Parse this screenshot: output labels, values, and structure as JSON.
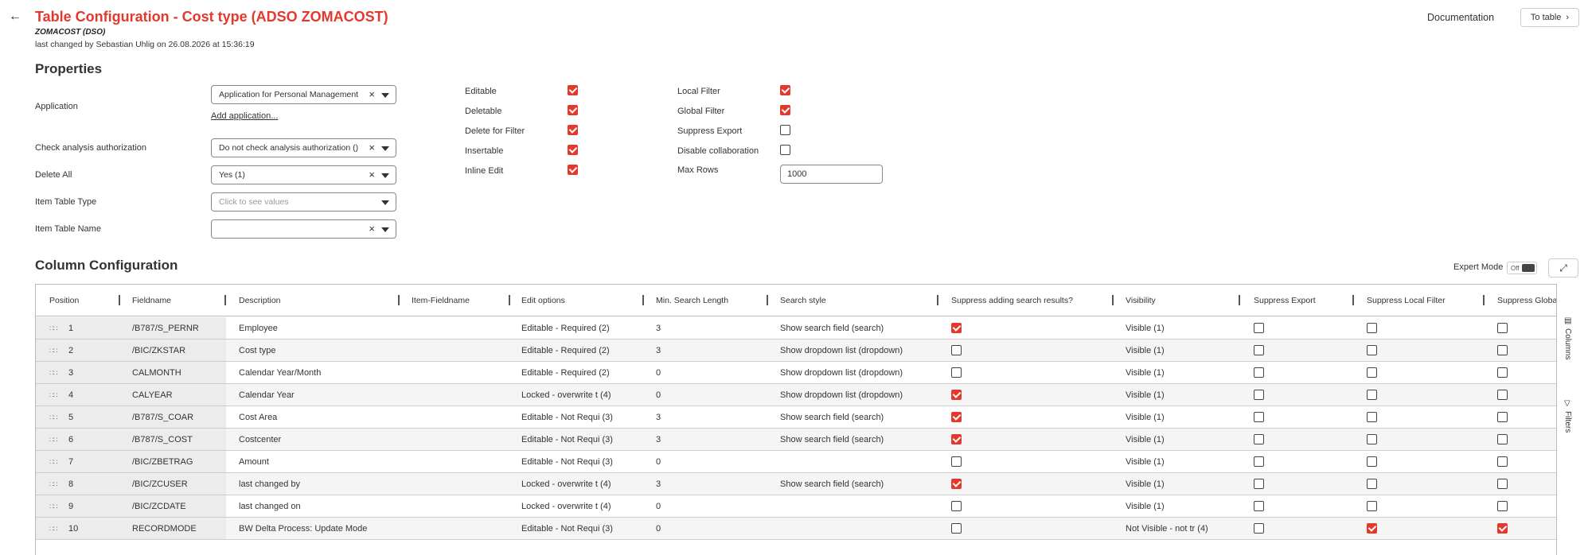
{
  "header": {
    "title": "Table Configuration - Cost type (ADSO ZOMACOST)",
    "subtitle": "ZOMACOST (DSO)",
    "changed": "last changed by Sebastian Uhlig on 26.08.2026 at 15:36:19",
    "documentation": "Documentation",
    "to_table": "To table"
  },
  "properties": {
    "heading": "Properties",
    "application": {
      "label": "Application",
      "value": "Application for Personal Management",
      "add": "Add application..."
    },
    "check_auth": {
      "label": "Check analysis authorization",
      "value": "Do not check analysis authorization ()"
    },
    "delete_all": {
      "label": "Delete All",
      "value": "Yes (1)"
    },
    "item_table_type": {
      "label": "Item Table Type",
      "placeholder": "Click to see values"
    },
    "item_table_name": {
      "label": "Item Table Name",
      "value": ""
    },
    "flags_left": [
      {
        "label": "Editable",
        "checked": true
      },
      {
        "label": "Deletable",
        "checked": true
      },
      {
        "label": "Delete for Filter",
        "checked": true
      },
      {
        "label": "Insertable",
        "checked": true
      },
      {
        "label": "Inline Edit",
        "checked": true
      }
    ],
    "flags_right": [
      {
        "label": "Local Filter",
        "checked": true
      },
      {
        "label": "Global Filter",
        "checked": true
      },
      {
        "label": "Suppress Export",
        "checked": false
      },
      {
        "label": "Disable collaboration",
        "checked": false
      }
    ],
    "max_rows": {
      "label": "Max Rows",
      "value": "1000"
    }
  },
  "columns": {
    "heading": "Column Configuration",
    "expert_mode": "Expert Mode",
    "toggle_state": "Off",
    "side_columns": "Columns",
    "side_filters": "Filters",
    "headers": [
      "Position",
      "Fieldname",
      "Description",
      "Item-Fieldname",
      "Edit options",
      "Min. Search Length",
      "Search style",
      "Suppress adding search results?",
      "Visibility",
      "Suppress Export",
      "Suppress Local Filter",
      "Suppress Global Filter"
    ],
    "rows": [
      {
        "pos": "1",
        "field": "/B787/S_PERNR",
        "desc": "Employee",
        "item": "",
        "edit": "Editable - Required (2)",
        "min": "3",
        "style": "Show search field (search)",
        "sup_add": true,
        "vis": "Visible (1)",
        "sup_exp": false,
        "sup_loc": false,
        "sup_glob": false
      },
      {
        "pos": "2",
        "field": "/BIC/ZKSTAR",
        "desc": "Cost type",
        "item": "",
        "edit": "Editable - Required (2)",
        "min": "3",
        "style": "Show dropdown list (dropdown)",
        "sup_add": false,
        "vis": "Visible (1)",
        "sup_exp": false,
        "sup_loc": false,
        "sup_glob": false
      },
      {
        "pos": "3",
        "field": "CALMONTH",
        "desc": "Calendar Year/Month",
        "item": "",
        "edit": "Editable - Required (2)",
        "min": "0",
        "style": "Show dropdown list (dropdown)",
        "sup_add": false,
        "vis": "Visible (1)",
        "sup_exp": false,
        "sup_loc": false,
        "sup_glob": false
      },
      {
        "pos": "4",
        "field": "CALYEAR",
        "desc": "Calendar Year",
        "item": "",
        "edit": "Locked - overwrite t (4)",
        "min": "0",
        "style": "Show dropdown list (dropdown)",
        "sup_add": true,
        "vis": "Visible (1)",
        "sup_exp": false,
        "sup_loc": false,
        "sup_glob": false
      },
      {
        "pos": "5",
        "field": "/B787/S_COAR",
        "desc": "Cost Area",
        "item": "",
        "edit": "Editable - Not Requi (3)",
        "min": "3",
        "style": "Show search field (search)",
        "sup_add": true,
        "vis": "Visible (1)",
        "sup_exp": false,
        "sup_loc": false,
        "sup_glob": false
      },
      {
        "pos": "6",
        "field": "/B787/S_COST",
        "desc": "Costcenter",
        "item": "",
        "edit": "Editable - Not Requi (3)",
        "min": "3",
        "style": "Show search field (search)",
        "sup_add": true,
        "vis": "Visible (1)",
        "sup_exp": false,
        "sup_loc": false,
        "sup_glob": false
      },
      {
        "pos": "7",
        "field": "/BIC/ZBETRAG",
        "desc": "Amount",
        "item": "",
        "edit": "Editable - Not Requi (3)",
        "min": "0",
        "style": "",
        "sup_add": false,
        "vis": "Visible (1)",
        "sup_exp": false,
        "sup_loc": false,
        "sup_glob": false
      },
      {
        "pos": "8",
        "field": "/BIC/ZCUSER",
        "desc": "last changed by",
        "item": "",
        "edit": "Locked - overwrite t (4)",
        "min": "3",
        "style": "Show search field (search)",
        "sup_add": true,
        "vis": "Visible (1)",
        "sup_exp": false,
        "sup_loc": false,
        "sup_glob": false
      },
      {
        "pos": "9",
        "field": "/BIC/ZCDATE",
        "desc": "last changed on",
        "item": "",
        "edit": "Locked - overwrite t (4)",
        "min": "0",
        "style": "",
        "sup_add": false,
        "vis": "Visible (1)",
        "sup_exp": false,
        "sup_loc": false,
        "sup_glob": false
      },
      {
        "pos": "10",
        "field": "RECORDMODE",
        "desc": "BW Delta Process: Update Mode",
        "item": "",
        "edit": "Editable - Not Requi (3)",
        "min": "0",
        "style": "",
        "sup_add": false,
        "vis": "Not Visible - not tr (4)",
        "sup_exp": false,
        "sup_loc": true,
        "sup_glob": true
      }
    ]
  }
}
